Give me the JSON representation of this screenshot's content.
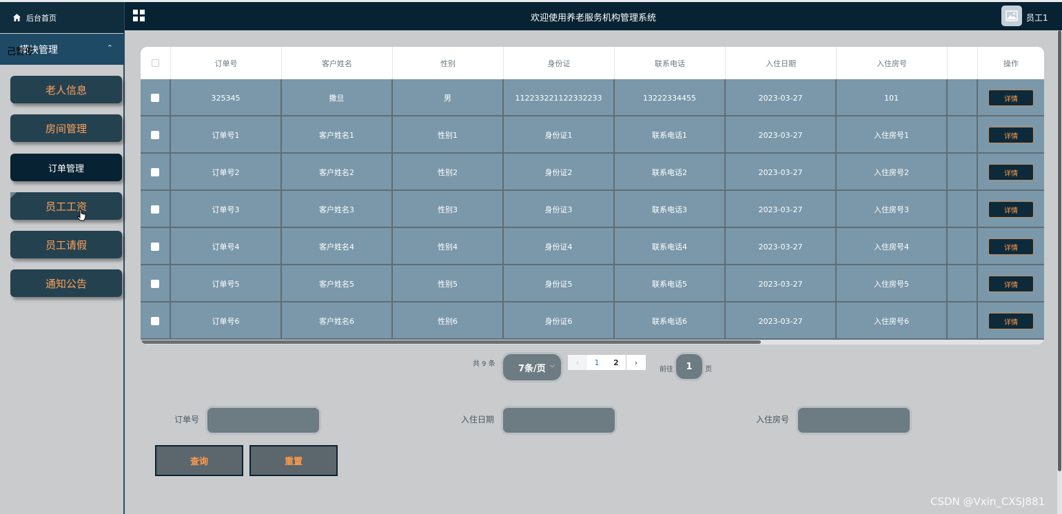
{
  "header": {
    "title": "欢迎使用养老服务机构管理系统",
    "user_name": "员工1"
  },
  "sidebar": {
    "home_label": "后台首页",
    "module_label": "模块管理",
    "module_overlay": "己暂停",
    "items": [
      {
        "label": "老人信息"
      },
      {
        "label": "房间管理"
      },
      {
        "label": "订单管理"
      },
      {
        "label": "员工工资"
      },
      {
        "label": "员工请假"
      },
      {
        "label": "通知公告"
      }
    ]
  },
  "table": {
    "columns": [
      "订单号",
      "客户姓名",
      "性别",
      "身份证",
      "联系电话",
      "入住日期",
      "入住房号",
      "",
      "操作"
    ],
    "rows": [
      [
        "325345",
        "撒旦",
        "男",
        "112233221122332233",
        "13222334455",
        "2023-03-27",
        "101"
      ],
      [
        "订单号1",
        "客户姓名1",
        "性别1",
        "身份证1",
        "联系电话1",
        "2023-03-27",
        "入住房号1"
      ],
      [
        "订单号2",
        "客户姓名2",
        "性别2",
        "身份证2",
        "联系电话2",
        "2023-03-27",
        "入住房号2"
      ],
      [
        "订单号3",
        "客户姓名3",
        "性别3",
        "身份证3",
        "联系电话3",
        "2023-03-27",
        "入住房号3"
      ],
      [
        "订单号4",
        "客户姓名4",
        "性别4",
        "身份证4",
        "联系电话4",
        "2023-03-27",
        "入住房号4"
      ],
      [
        "订单号5",
        "客户姓名5",
        "性别5",
        "身份证5",
        "联系电话5",
        "2023-03-27",
        "入住房号5"
      ],
      [
        "订单号6",
        "客户姓名6",
        "性别6",
        "身份证6",
        "联系电话6",
        "2023-03-27",
        "入住房号6"
      ]
    ],
    "detail_label": "详情"
  },
  "pagination": {
    "total_text": "共 9 条",
    "page_size": "7条/页",
    "pages": [
      "1",
      "2"
    ],
    "prev_symbol": "‹",
    "next_symbol": "›",
    "goto_label": "前往",
    "goto_value": "1",
    "page_suffix": "页"
  },
  "search": {
    "fields": [
      {
        "label": "订单号",
        "value": ""
      },
      {
        "label": "入住日期",
        "value": ""
      },
      {
        "label": "入住房号",
        "value": ""
      }
    ],
    "query_label": "查询",
    "reset_label": "重置"
  },
  "watermark": "CSDN @Vxin_CXSJ881"
}
